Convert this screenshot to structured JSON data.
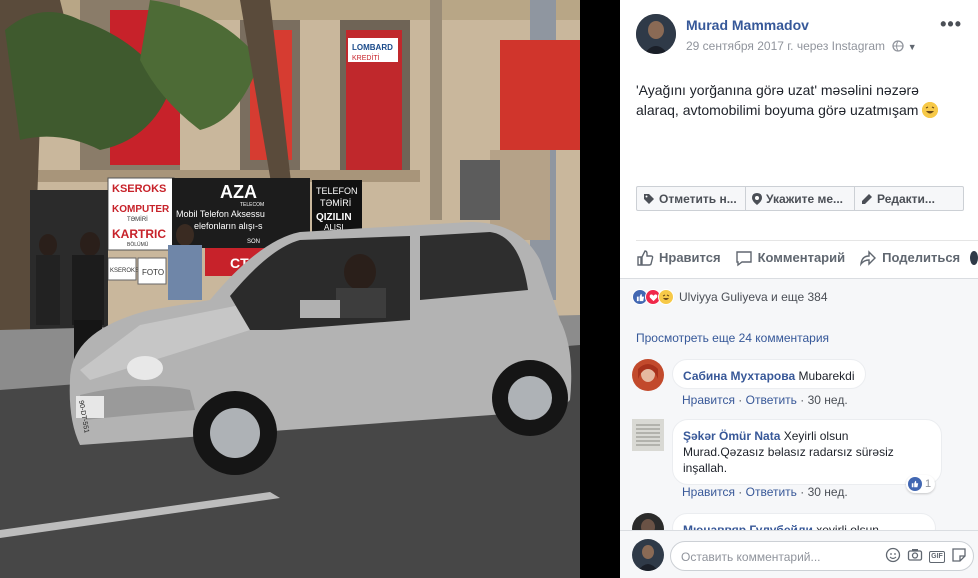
{
  "post": {
    "author": "Murad Mammadov",
    "date": "29 сентября 2017 г. через Instagram",
    "more_label": "•••",
    "text_line1": "'Ayağını yorğanına görə uzat' məsəlini nəzərə",
    "text_line2": "alaraq, avtomobilimi boyuma görə uzatmışam",
    "emoji_icon": "laughing-emoji-icon"
  },
  "photo": {
    "sign_xeroks": "KSEROKS",
    "sign_komputer": "KOMPUTER",
    "sign_temiri": "TƏMİRİ",
    "sign_kartric": "KARTRIC",
    "sign_bolumu": "BÖLÜMÜ",
    "sign_aza": "AZA",
    "sign_telecom": "TELECOM",
    "sign_mobil": "Mobil Telefon Aksessu",
    "sign_telefonlarin": "elefonların alışı-s",
    "sign_son": "SON",
    "sign_telefon": "TELEFON",
    "sign_temiri2": "TƏMİRİ",
    "sign_qizilin": "QIZILIN",
    "sign_alisi": "ALIŞI",
    "sign_lombard": "LOMBARD",
    "sign_krediti": "KREDİTİ",
    "sign_xeroks2": "KSEROKS",
    "sign_foto": "FOTO",
    "sign_ct": "CT",
    "sign_plate": "90-DT-551"
  },
  "tagbar": [
    {
      "label": "Отметить н...",
      "icon": "tag-icon"
    },
    {
      "label": "Укажите ме...",
      "icon": "location-pin-icon"
    },
    {
      "label": "Редакти...",
      "icon": "pencil-icon"
    }
  ],
  "actions": {
    "like": "Нравится",
    "comment": "Комментарий",
    "share": "Поделиться"
  },
  "reactions": {
    "summary": "Ulviyya Guliyeva и еще 384"
  },
  "view_more": "Просмотреть еще 24 комментария",
  "comments": [
    {
      "name": "Сабина Мухтарова",
      "text": "Mubarekdi",
      "like": "Нравится",
      "reply": "Ответить",
      "time": "30 нед."
    },
    {
      "name": "Şəkər Ömür Nata",
      "text_a": "Xeyirli olsun",
      "text_b": "Murad.Qəzasız bəlasız radarsız sürəsiz",
      "text_c": "inşallah.",
      "like": "Нравится",
      "reply": "Ответить",
      "time": "30 нед.",
      "likes": "1"
    },
    {
      "name": "Мюнаввяр Гулубейли",
      "text": "xeyirli olsun"
    }
  ],
  "composer": {
    "placeholder": "Оставить комментарий...",
    "gif": "GIF"
  },
  "colors": {
    "link": "#365899",
    "like_blue": "#4267b2",
    "love_red": "#f0284a",
    "haha_yellow": "#f7c948"
  }
}
